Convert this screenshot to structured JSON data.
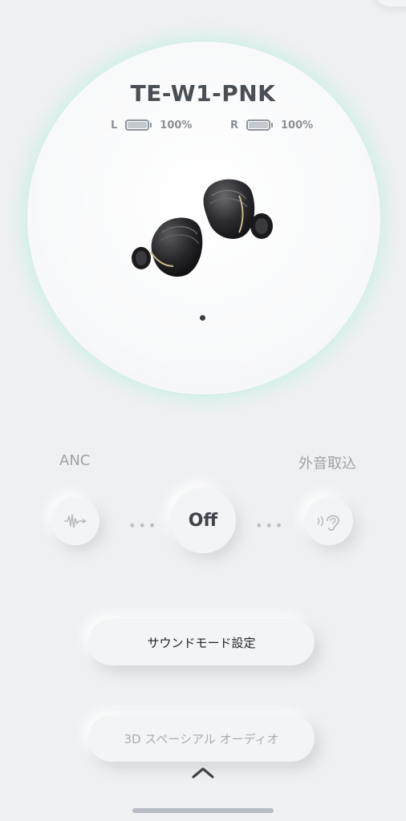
{
  "device": {
    "name": "TE-W1-PNK",
    "left": {
      "side": "L",
      "battery": "100%"
    },
    "right": {
      "side": "R",
      "battery": "100%"
    }
  },
  "modes": {
    "anc_label": "ANC",
    "ambient_label": "外音取込",
    "current": "Off"
  },
  "buttons": {
    "sound_mode": "サウンドモード設定",
    "spatial_audio": "3D スペーシアル オーディオ"
  },
  "icons": {
    "anc": "waveform-icon",
    "ambient": "ear-icon",
    "expand": "chevron-up-icon"
  },
  "colors": {
    "background": "#eff0f2",
    "glow": "#b0eede",
    "text_dark": "#3f444a",
    "text_muted": "#9ca2a8"
  }
}
